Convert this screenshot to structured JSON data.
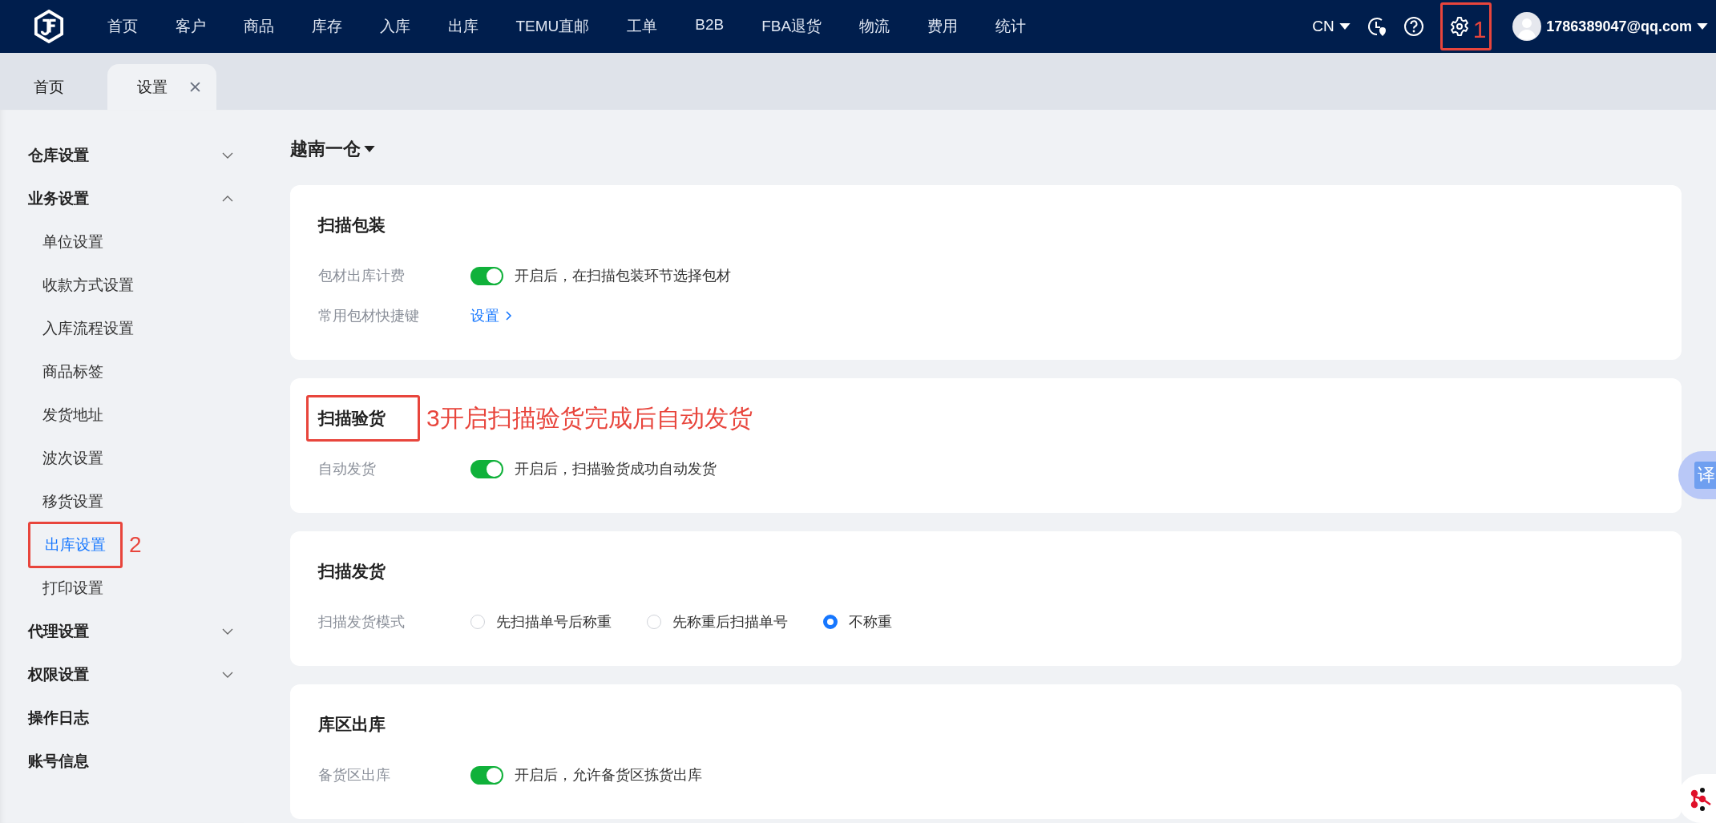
{
  "topbar": {
    "nav": [
      "首页",
      "客户",
      "商品",
      "库存",
      "入库",
      "出库",
      "TEMU直邮",
      "工单",
      "B2B",
      "FBA退货",
      "物流",
      "费用",
      "统计"
    ],
    "language": "CN",
    "settings_annotation": "1",
    "user": "1786389047@qq.com"
  },
  "tabs": [
    {
      "label": "首页",
      "selected": false,
      "closable": false
    },
    {
      "label": "设置",
      "selected": true,
      "closable": true
    }
  ],
  "sidebar": {
    "items": [
      {
        "label": "仓库设置",
        "expanded": false
      },
      {
        "label": "业务设置",
        "expanded": true,
        "children": [
          {
            "label": "单位设置",
            "selected": false
          },
          {
            "label": "收款方式设置",
            "selected": false
          },
          {
            "label": "入库流程设置",
            "selected": false
          },
          {
            "label": "商品标签",
            "selected": false
          },
          {
            "label": "发货地址",
            "selected": false
          },
          {
            "label": "波次设置",
            "selected": false
          },
          {
            "label": "移货设置",
            "selected": false
          },
          {
            "label": "出库设置",
            "selected": true,
            "annotation": "2"
          },
          {
            "label": "打印设置",
            "selected": false
          }
        ]
      },
      {
        "label": "代理设置",
        "expanded": false
      },
      {
        "label": "权限设置",
        "expanded": false
      },
      {
        "label": "操作日志"
      },
      {
        "label": "账号信息"
      }
    ]
  },
  "warehouse": "越南一仓",
  "cards": [
    {
      "title": "扫描包装",
      "rows": [
        {
          "kind": "toggle",
          "label": "包材出库计费",
          "on": true,
          "text": "开启后，在扫描包装环节选择包材"
        },
        {
          "kind": "link",
          "label": "常用包材快捷键",
          "link": "设置"
        }
      ]
    },
    {
      "title": "扫描验货",
      "annotation": "3开启扫描验货完成后自动发货",
      "rows": [
        {
          "kind": "toggle",
          "label": "自动发货",
          "on": true,
          "text": "开启后，扫描验货成功自动发货"
        }
      ]
    },
    {
      "title": "扫描发货",
      "rows": [
        {
          "kind": "radio",
          "label": "扫描发货模式",
          "options": [
            {
              "label": "先扫描单号后称重",
              "selected": false
            },
            {
              "label": "先称重后扫描单号",
              "selected": false
            },
            {
              "label": "不称重",
              "selected": true
            }
          ]
        }
      ]
    },
    {
      "title": "库区出库",
      "rows": [
        {
          "kind": "toggle",
          "label": "备货区出库",
          "on": true,
          "text": "开启后，允许备货区拣货出库"
        }
      ]
    }
  ],
  "translate_widget": {
    "label": "译"
  }
}
